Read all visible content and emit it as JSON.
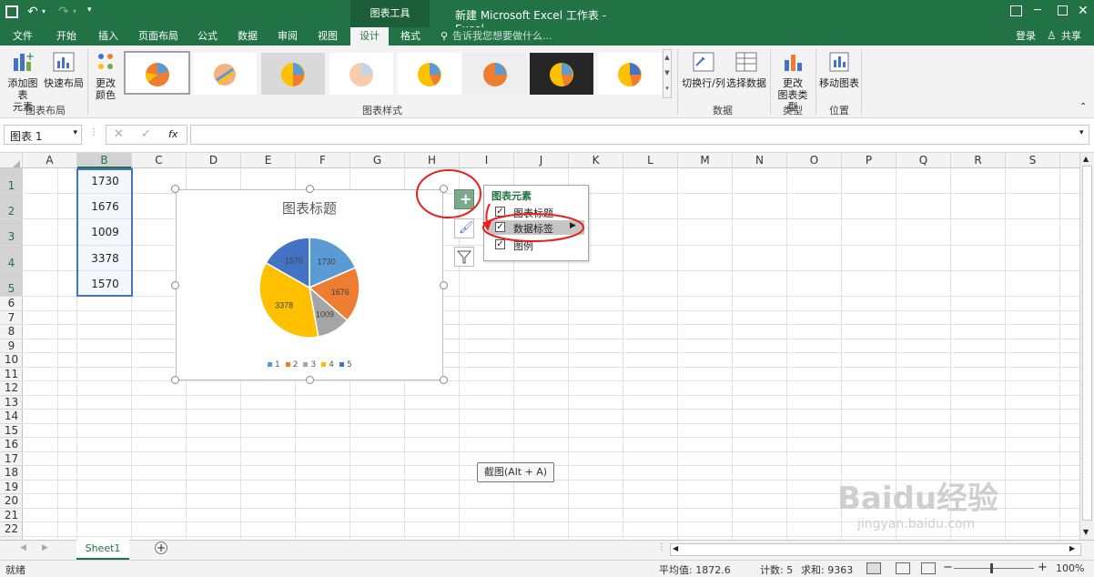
{
  "titlebar": {
    "context_tab": "图表工具",
    "title": "新建 Microsoft Excel 工作表 - Excel"
  },
  "tabs": [
    "文件",
    "开始",
    "插入",
    "页面布局",
    "公式",
    "数据",
    "审阅",
    "视图",
    "设计",
    "格式"
  ],
  "tell_me": "告诉我您想要做什么...",
  "login": "登录",
  "share": "共享",
  "ribbon": {
    "add_element": "添加图表\n元素",
    "quick_layout": "快速布局",
    "change_color": "更改\n颜色",
    "group_layout": "图表布局",
    "group_styles": "图表样式",
    "switch_rowcol": "切换行/列",
    "select_data": "选择数据",
    "group_data": "数据",
    "change_type": "更改\n图表类型",
    "group_type": "类型",
    "move_chart": "移动图表",
    "group_location": "位置"
  },
  "namebox": "图表 1",
  "fx": "fx",
  "columns": [
    "A",
    "B",
    "C",
    "D",
    "E",
    "F",
    "G",
    "H",
    "I",
    "J",
    "K",
    "L",
    "M",
    "N",
    "O",
    "P",
    "Q",
    "R",
    "S"
  ],
  "rows": [
    "1",
    "2",
    "3",
    "4",
    "5",
    "6",
    "7",
    "8",
    "9",
    "10",
    "11",
    "12",
    "13",
    "14",
    "15",
    "16",
    "17",
    "18",
    "19",
    "20",
    "21",
    "22"
  ],
  "cells_B": [
    "1730",
    "1676",
    "1009",
    "3378",
    "1570"
  ],
  "chart_data": {
    "type": "pie",
    "title": "图表标题",
    "categories": [
      "1",
      "2",
      "3",
      "4",
      "5"
    ],
    "values": [
      1730,
      1676,
      1009,
      3378,
      1570
    ],
    "colors": [
      "#5b9bd5",
      "#ed7d31",
      "#a5a5a5",
      "#ffc000",
      "#4472c4"
    ],
    "legend": "bottom"
  },
  "flyout": {
    "header": "图表元素",
    "items": [
      {
        "label": "图表标题",
        "checked": true
      },
      {
        "label": "数据标签",
        "checked": true
      },
      {
        "label": "图例",
        "checked": true
      }
    ]
  },
  "tooltip": "截图(Alt + A)",
  "sheet_tab": "Sheet1",
  "status": {
    "ready": "就绪",
    "average": "平均值: 1872.6",
    "count": "计数: 5",
    "sum": "求和: 9363",
    "zoom": "100%"
  },
  "watermark": {
    "brand": "Baidu经验",
    "url": "jingyan.baidu.com"
  },
  "colors": {
    "accent": "#217346",
    "annotation": "#e8211d"
  }
}
